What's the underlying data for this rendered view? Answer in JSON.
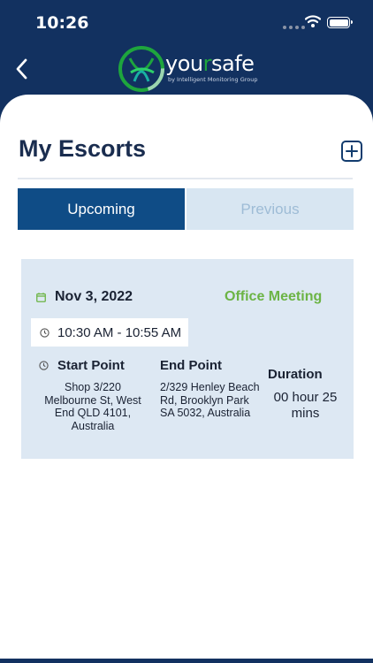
{
  "status_bar": {
    "time": "10:26"
  },
  "header": {
    "logo_text_prefix": "you",
    "logo_text_r": "r",
    "logo_text_suffix": "safe",
    "logo_subtitle": "by Intelligent Monitoring Group"
  },
  "page": {
    "title": "My Escorts"
  },
  "tabs": [
    {
      "label": "Upcoming",
      "active": true
    },
    {
      "label": "Previous",
      "active": false
    }
  ],
  "escort": {
    "date": "Nov 3, 2022",
    "type": "Office Meeting",
    "time_range": "10:30 AM - 10:55 AM",
    "start_label": "Start Point",
    "start_address": "Shop 3/220 Melbourne St, West End QLD 4101, Australia",
    "end_label": "End Point",
    "end_address": "2/329 Henley Beach Rd, Brooklyn Park SA 5032, Australia",
    "duration_label": "Duration",
    "duration_value": "00 hour 25 mins"
  },
  "colors": {
    "header_bg": "#123160",
    "accent_green": "#6cb445",
    "tab_active": "#0f4c86",
    "card_bg": "#dde8f3"
  },
  "icons": [
    "back-chevron-icon",
    "add-icon",
    "calendar-icon",
    "clock-icon",
    "wifi-icon",
    "battery-icon"
  ]
}
